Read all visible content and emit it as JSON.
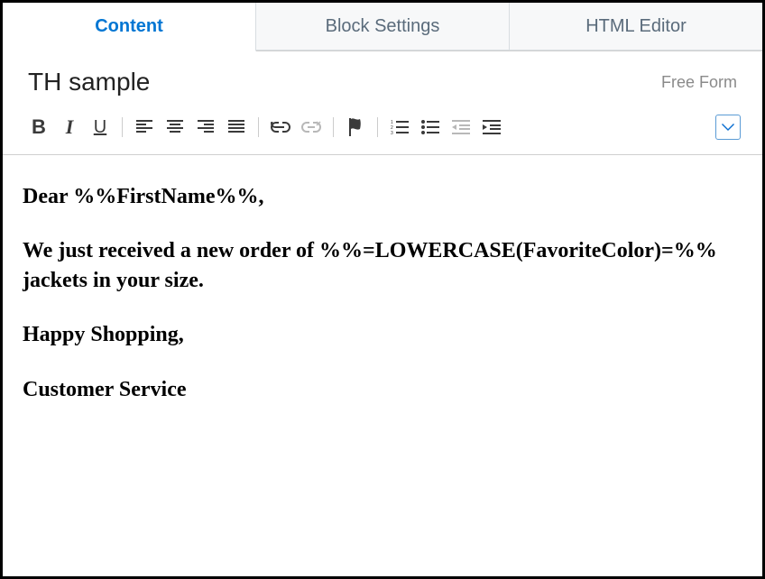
{
  "tabs": {
    "content": "Content",
    "block_settings": "Block Settings",
    "html_editor": "HTML Editor"
  },
  "header": {
    "title": "TH sample",
    "form_type": "Free Form"
  },
  "toolbar": {
    "bold": "B",
    "italic": "I",
    "underline": "U"
  },
  "content": {
    "p1": "Dear %%FirstName%%,",
    "p2": "We just received a new order of %%=LOWERCASE(FavoriteColor)=%% jackets in your size.",
    "p3": "Happy Shopping,",
    "p4": "Customer Service"
  }
}
